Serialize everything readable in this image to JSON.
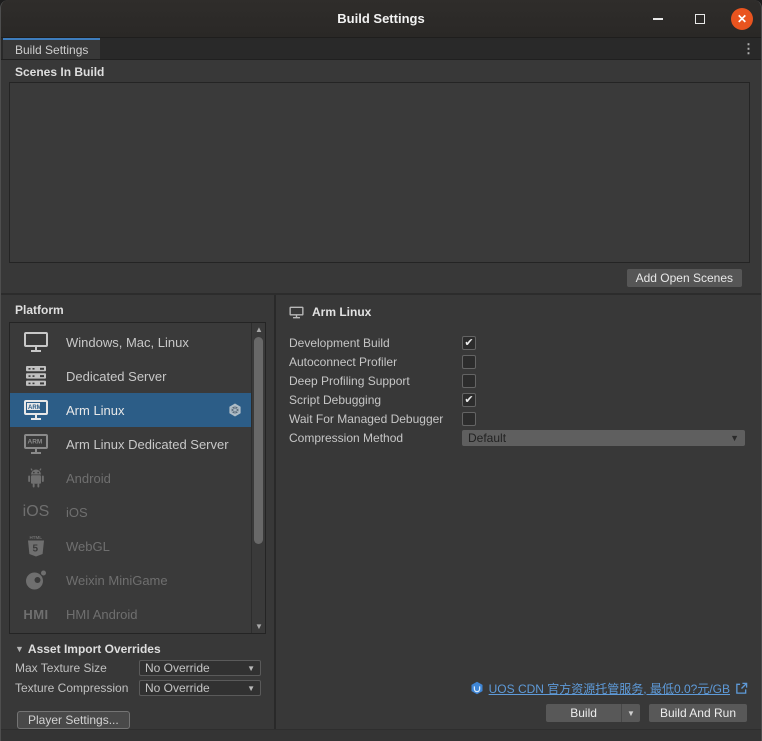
{
  "window": {
    "title": "Build Settings"
  },
  "tabbar": {
    "active_tab": "Build Settings"
  },
  "scenes": {
    "title": "Scenes In Build",
    "add_button": "Add Open Scenes"
  },
  "platform": {
    "title": "Platform",
    "items": [
      {
        "label": "Windows, Mac, Linux",
        "icon": "monitor",
        "state": "enabled"
      },
      {
        "label": "Dedicated Server",
        "icon": "server",
        "state": "enabled"
      },
      {
        "label": "Arm Linux",
        "icon": "arm-monitor",
        "state": "selected",
        "badge": "unity-cube"
      },
      {
        "label": "Arm Linux Dedicated Server",
        "icon": "arm-monitor",
        "state": "enabled"
      },
      {
        "label": "Android",
        "icon": "android",
        "state": "disabled"
      },
      {
        "label": "iOS",
        "icon": "ios-text",
        "state": "disabled"
      },
      {
        "label": "WebGL",
        "icon": "html5-shield",
        "state": "disabled"
      },
      {
        "label": "Weixin MiniGame",
        "icon": "weixin",
        "state": "disabled"
      },
      {
        "label": "HMI Android",
        "icon": "hmi-text",
        "state": "disabled"
      }
    ]
  },
  "settings": {
    "header": "Arm Linux",
    "toggles": [
      {
        "label": "Development Build",
        "checked": true
      },
      {
        "label": "Autoconnect Profiler",
        "checked": false
      },
      {
        "label": "Deep Profiling Support",
        "checked": false
      },
      {
        "label": "Script Debugging",
        "checked": true
      },
      {
        "label": "Wait For Managed Debugger",
        "checked": false
      }
    ],
    "compression": {
      "label": "Compression Method",
      "value": "Default"
    }
  },
  "asset_overrides": {
    "title": "Asset Import Overrides",
    "rows": [
      {
        "label": "Max Texture Size",
        "value": "No Override"
      },
      {
        "label": "Texture Compression",
        "value": "No Override"
      }
    ]
  },
  "footer": {
    "player_settings": "Player Settings...",
    "uos_link": "UOS CDN 官方资源托管服务, 最低0.0?元/GB",
    "build": "Build",
    "build_and_run": "Build And Run"
  },
  "colors": {
    "selection": "#2c5d87",
    "close_button": "#e9541f",
    "tab_accent": "#3e7dbd",
    "link": "#5e9ad8"
  }
}
